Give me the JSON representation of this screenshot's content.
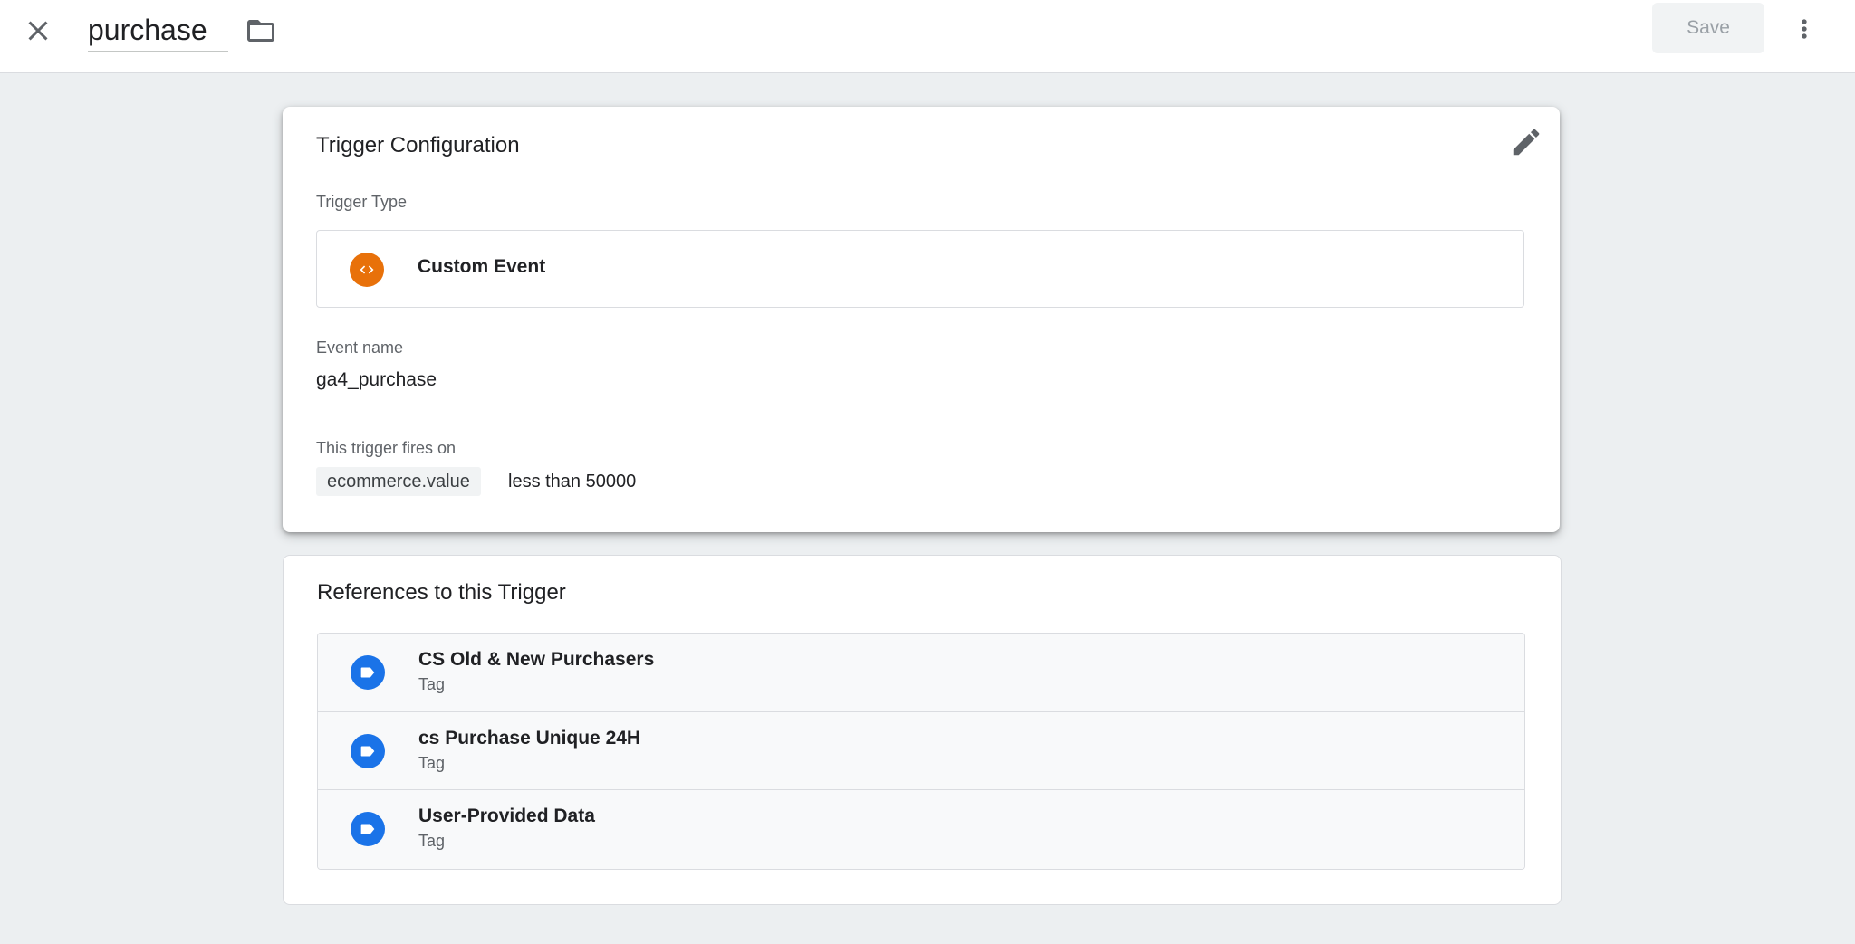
{
  "header": {
    "trigger_name": "purchase",
    "save_label": "Save"
  },
  "config": {
    "title": "Trigger Configuration",
    "trigger_type_label": "Trigger Type",
    "trigger_type": "Custom Event",
    "trigger_type_icon": "code-brackets-icon",
    "trigger_type_color": "#e8710a",
    "event_name_label": "Event name",
    "event_name": "ga4_purchase",
    "fires_on_label": "This trigger fires on",
    "condition_variable": "ecommerce.value",
    "condition_rule": "less than 50000"
  },
  "references": {
    "title": "References to this Trigger",
    "icon": "tag-icon",
    "icon_color": "#1a73e8",
    "items": [
      {
        "name": "CS Old & New Purchasers",
        "type": "Tag"
      },
      {
        "name": "cs Purchase Unique 24H",
        "type": "Tag"
      },
      {
        "name": "User-Provided Data",
        "type": "Tag"
      }
    ]
  }
}
